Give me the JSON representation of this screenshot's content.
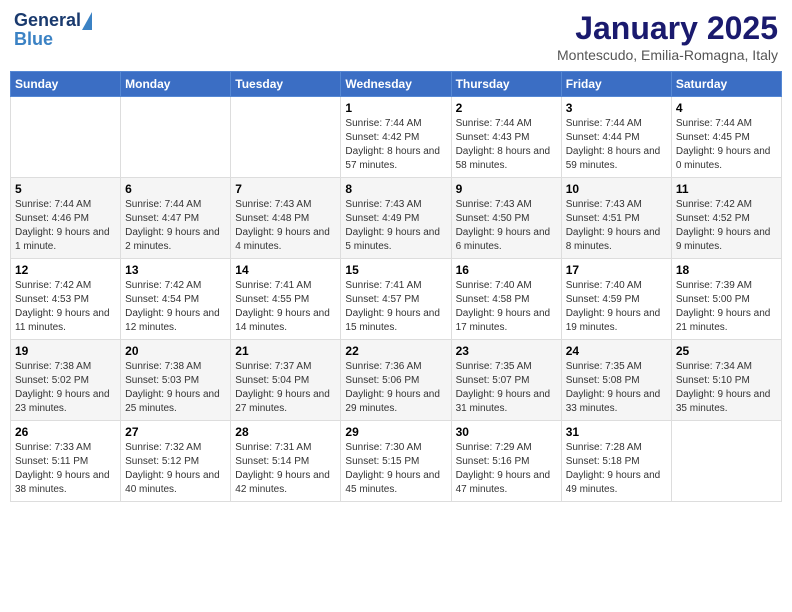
{
  "header": {
    "logo_general": "General",
    "logo_blue": "Blue",
    "month_year": "January 2025",
    "location": "Montescudo, Emilia-Romagna, Italy"
  },
  "days_of_week": [
    "Sunday",
    "Monday",
    "Tuesday",
    "Wednesday",
    "Thursday",
    "Friday",
    "Saturday"
  ],
  "weeks": [
    [
      {
        "day": "",
        "info": ""
      },
      {
        "day": "",
        "info": ""
      },
      {
        "day": "",
        "info": ""
      },
      {
        "day": "1",
        "info": "Sunrise: 7:44 AM\nSunset: 4:42 PM\nDaylight: 8 hours and 57 minutes."
      },
      {
        "day": "2",
        "info": "Sunrise: 7:44 AM\nSunset: 4:43 PM\nDaylight: 8 hours and 58 minutes."
      },
      {
        "day": "3",
        "info": "Sunrise: 7:44 AM\nSunset: 4:44 PM\nDaylight: 8 hours and 59 minutes."
      },
      {
        "day": "4",
        "info": "Sunrise: 7:44 AM\nSunset: 4:45 PM\nDaylight: 9 hours and 0 minutes."
      }
    ],
    [
      {
        "day": "5",
        "info": "Sunrise: 7:44 AM\nSunset: 4:46 PM\nDaylight: 9 hours and 1 minute."
      },
      {
        "day": "6",
        "info": "Sunrise: 7:44 AM\nSunset: 4:47 PM\nDaylight: 9 hours and 2 minutes."
      },
      {
        "day": "7",
        "info": "Sunrise: 7:43 AM\nSunset: 4:48 PM\nDaylight: 9 hours and 4 minutes."
      },
      {
        "day": "8",
        "info": "Sunrise: 7:43 AM\nSunset: 4:49 PM\nDaylight: 9 hours and 5 minutes."
      },
      {
        "day": "9",
        "info": "Sunrise: 7:43 AM\nSunset: 4:50 PM\nDaylight: 9 hours and 6 minutes."
      },
      {
        "day": "10",
        "info": "Sunrise: 7:43 AM\nSunset: 4:51 PM\nDaylight: 9 hours and 8 minutes."
      },
      {
        "day": "11",
        "info": "Sunrise: 7:42 AM\nSunset: 4:52 PM\nDaylight: 9 hours and 9 minutes."
      }
    ],
    [
      {
        "day": "12",
        "info": "Sunrise: 7:42 AM\nSunset: 4:53 PM\nDaylight: 9 hours and 11 minutes."
      },
      {
        "day": "13",
        "info": "Sunrise: 7:42 AM\nSunset: 4:54 PM\nDaylight: 9 hours and 12 minutes."
      },
      {
        "day": "14",
        "info": "Sunrise: 7:41 AM\nSunset: 4:55 PM\nDaylight: 9 hours and 14 minutes."
      },
      {
        "day": "15",
        "info": "Sunrise: 7:41 AM\nSunset: 4:57 PM\nDaylight: 9 hours and 15 minutes."
      },
      {
        "day": "16",
        "info": "Sunrise: 7:40 AM\nSunset: 4:58 PM\nDaylight: 9 hours and 17 minutes."
      },
      {
        "day": "17",
        "info": "Sunrise: 7:40 AM\nSunset: 4:59 PM\nDaylight: 9 hours and 19 minutes."
      },
      {
        "day": "18",
        "info": "Sunrise: 7:39 AM\nSunset: 5:00 PM\nDaylight: 9 hours and 21 minutes."
      }
    ],
    [
      {
        "day": "19",
        "info": "Sunrise: 7:38 AM\nSunset: 5:02 PM\nDaylight: 9 hours and 23 minutes."
      },
      {
        "day": "20",
        "info": "Sunrise: 7:38 AM\nSunset: 5:03 PM\nDaylight: 9 hours and 25 minutes."
      },
      {
        "day": "21",
        "info": "Sunrise: 7:37 AM\nSunset: 5:04 PM\nDaylight: 9 hours and 27 minutes."
      },
      {
        "day": "22",
        "info": "Sunrise: 7:36 AM\nSunset: 5:06 PM\nDaylight: 9 hours and 29 minutes."
      },
      {
        "day": "23",
        "info": "Sunrise: 7:35 AM\nSunset: 5:07 PM\nDaylight: 9 hours and 31 minutes."
      },
      {
        "day": "24",
        "info": "Sunrise: 7:35 AM\nSunset: 5:08 PM\nDaylight: 9 hours and 33 minutes."
      },
      {
        "day": "25",
        "info": "Sunrise: 7:34 AM\nSunset: 5:10 PM\nDaylight: 9 hours and 35 minutes."
      }
    ],
    [
      {
        "day": "26",
        "info": "Sunrise: 7:33 AM\nSunset: 5:11 PM\nDaylight: 9 hours and 38 minutes."
      },
      {
        "day": "27",
        "info": "Sunrise: 7:32 AM\nSunset: 5:12 PM\nDaylight: 9 hours and 40 minutes."
      },
      {
        "day": "28",
        "info": "Sunrise: 7:31 AM\nSunset: 5:14 PM\nDaylight: 9 hours and 42 minutes."
      },
      {
        "day": "29",
        "info": "Sunrise: 7:30 AM\nSunset: 5:15 PM\nDaylight: 9 hours and 45 minutes."
      },
      {
        "day": "30",
        "info": "Sunrise: 7:29 AM\nSunset: 5:16 PM\nDaylight: 9 hours and 47 minutes."
      },
      {
        "day": "31",
        "info": "Sunrise: 7:28 AM\nSunset: 5:18 PM\nDaylight: 9 hours and 49 minutes."
      },
      {
        "day": "",
        "info": ""
      }
    ]
  ]
}
